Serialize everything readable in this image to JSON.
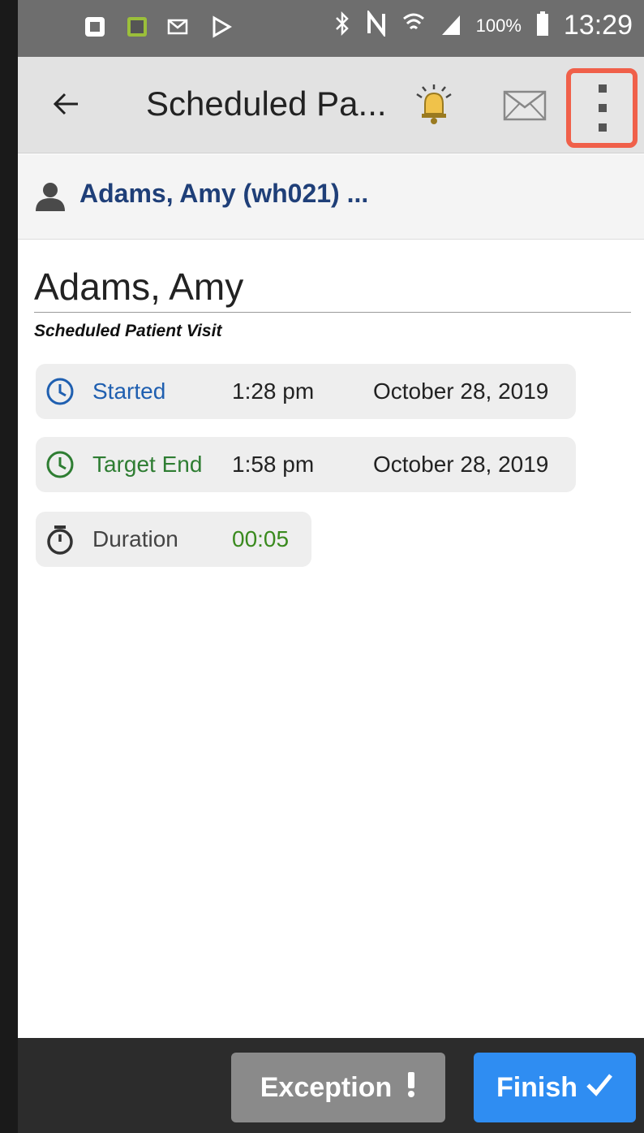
{
  "status_bar": {
    "battery": "100%",
    "time": "13:29",
    "icons": [
      "notification-app-icon",
      "notification-image-icon",
      "email-notification-icon",
      "play-store-icon",
      "bluetooth-icon",
      "nfc-icon",
      "wifi-icon",
      "signal-icon",
      "battery-icon"
    ]
  },
  "app_bar": {
    "title": "Scheduled Pa...",
    "icons": [
      "back-arrow-icon",
      "alarm-bell-icon",
      "mail-icon",
      "more-vert-icon"
    ]
  },
  "patient_bar": {
    "label": "Adams, Amy (wh021) ..."
  },
  "patient": {
    "name": "Adams, Amy",
    "visit_type": "Scheduled Patient Visit"
  },
  "rows": {
    "started": {
      "label": "Started",
      "time": "1:28 pm",
      "date": "October 28, 2019"
    },
    "target_end": {
      "label": "Target End",
      "time": "1:58 pm",
      "date": "October 28, 2019"
    },
    "duration": {
      "label": "Duration",
      "value": "00:05"
    }
  },
  "actions": {
    "exception_label": "Exception",
    "finish_label": "Finish"
  },
  "colors": {
    "blue": "#1f5fb0",
    "green": "#2e7d32",
    "highlight": "#f0604a",
    "finish": "#2f8df2"
  }
}
